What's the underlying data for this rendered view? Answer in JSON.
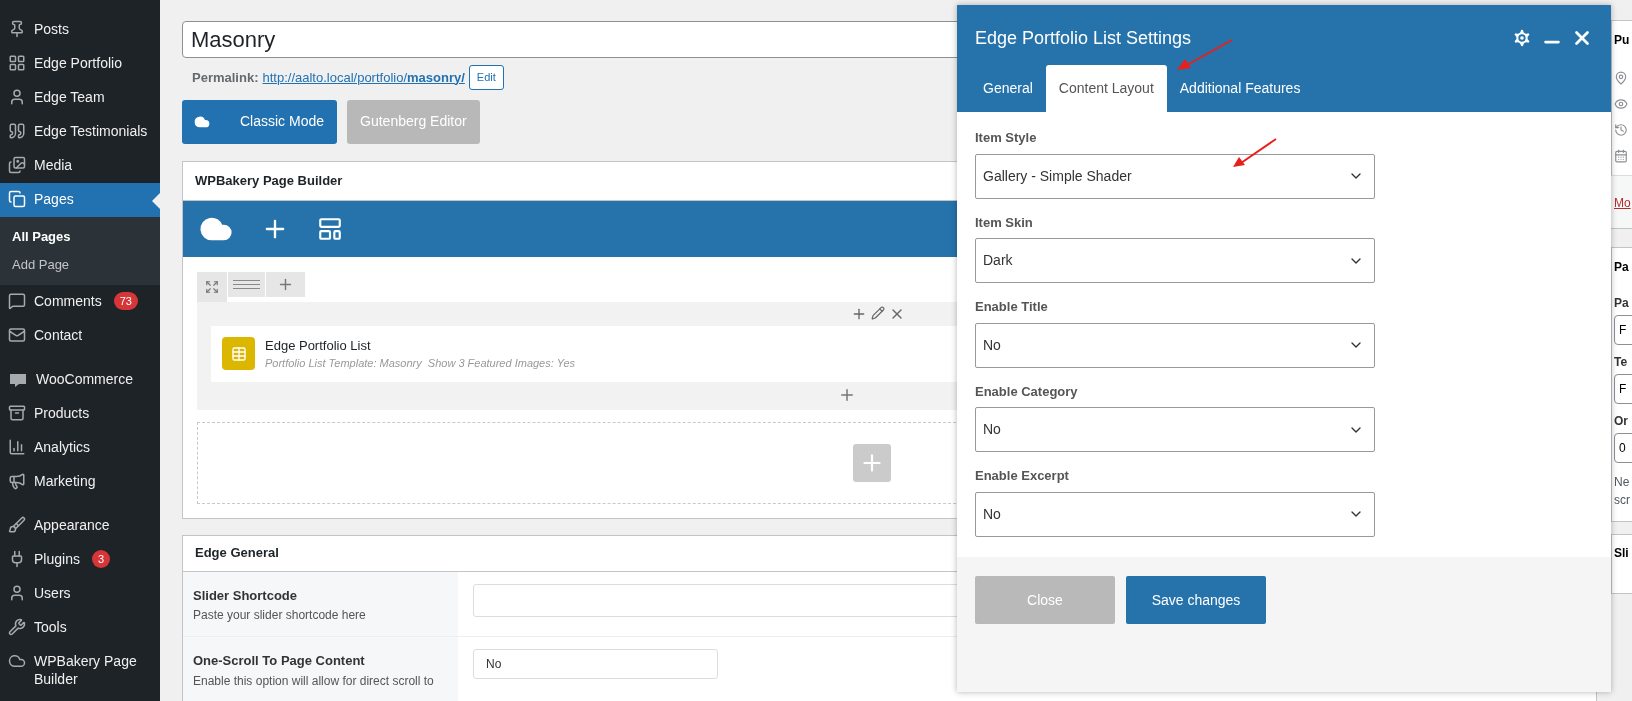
{
  "sidebar": {
    "menu_groups": [
      [
        {
          "label": "Posts",
          "selected": false
        },
        {
          "label": "Edge Portfolio",
          "selected": false
        },
        {
          "label": "Edge Team",
          "selected": false
        },
        {
          "label": "Edge Testimonials",
          "selected": false
        },
        {
          "label": "Media",
          "selected": false
        },
        {
          "label": "Pages",
          "selected": true,
          "children": [
            {
              "label": "All Pages",
              "selected": true
            },
            {
              "label": "Add Page",
              "selected": false
            }
          ]
        },
        {
          "label": "Comments",
          "selected": false,
          "badge": "73"
        },
        {
          "label": "Contact",
          "selected": false
        }
      ],
      [
        {
          "label": "WooCommerce",
          "selected": false
        },
        {
          "label": "Products",
          "selected": false
        },
        {
          "label": "Analytics",
          "selected": false
        },
        {
          "label": "Marketing",
          "selected": false
        }
      ],
      [
        {
          "label": "Appearance",
          "selected": false
        },
        {
          "label": "Plugins",
          "selected": false,
          "badge": "3"
        },
        {
          "label": "Users",
          "selected": false
        },
        {
          "label": "Tools",
          "selected": false
        },
        {
          "label": "WPBakery Page Builder",
          "selected": false
        }
      ]
    ]
  },
  "editor": {
    "title_field": {
      "value": "Masonry"
    },
    "permalink": {
      "label": "Permalink:",
      "url": "http://aalto.local/portfolio/**masonry/**",
      "edit_button": "Edit"
    },
    "mode_buttons": [
      {
        "label": "Classic Mode",
        "selected": true
      },
      {
        "label": "Gutenberg Editor",
        "selected": false
      }
    ],
    "page_builder": {
      "title": "WPBakery Page Builder",
      "element": {
        "name": "Edge Portfolio List",
        "summary": "Portfolio List Template: Masonry  Show 3 Featured Images: Yes"
      }
    },
    "edge_general": {
      "title": "Edge General",
      "fields": [
        {
          "label": "Slider Shortcode",
          "description": "Paste your slider shortcode here",
          "kind": "text"
        },
        {
          "label": "One-Scroll To Page Content",
          "description": "Enable this option will allow for direct scroll to",
          "kind": "select",
          "value": "No"
        }
      ]
    }
  },
  "modal": {
    "title": "Edge Portfolio List Settings",
    "tabs": [
      {
        "label": "General",
        "selected": false
      },
      {
        "label": "Content Layout",
        "selected": true
      },
      {
        "label": "Additional Features",
        "selected": false
      }
    ],
    "fields": [
      {
        "label": "Item Style",
        "value": "Gallery - Simple Shader"
      },
      {
        "label": "Item Skin",
        "value": "Dark"
      },
      {
        "label": "Enable Title",
        "value": "No"
      },
      {
        "label": "Enable Category",
        "value": "No"
      },
      {
        "label": "Enable Excerpt",
        "value": "No"
      }
    ],
    "buttons": [
      {
        "label": "Close",
        "kind": "secondary"
      },
      {
        "label": "Save changes",
        "kind": "primary"
      }
    ]
  },
  "right_column": {
    "publish_title": "Pu",
    "publish_link": "Mo",
    "attributes_title": "Pa",
    "attributes": [
      {
        "label": "Pa",
        "value": "F"
      },
      {
        "label": "Te",
        "value": "F"
      },
      {
        "label": "Or",
        "value": "0"
      }
    ],
    "note": "Ne scr",
    "slider_title": "Sli"
  }
}
